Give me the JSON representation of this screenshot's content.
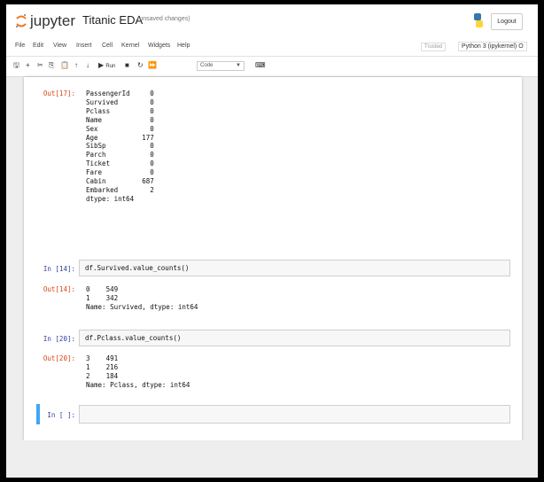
{
  "header": {
    "brand": "jupyter",
    "notebook_title": "Titanic EDA",
    "save_status": "(unsaved changes)",
    "logout_label": "Logout"
  },
  "menu": {
    "items": [
      "File",
      "Edit",
      "View",
      "Insert",
      "Cell",
      "Kernel",
      "Widgets",
      "Help"
    ],
    "trusted_label": "Trusted",
    "kernel_label": "Python 3 (ipykernel) O"
  },
  "toolbar": {
    "run_label": "Run",
    "cell_type": "Code"
  },
  "cells": {
    "out17": {
      "prompt": "Out[17]:",
      "text": "PassengerId     0\nSurvived        0\nPclass          0\nName            0\nSex             0\nAge           177\nSibSp           0\nParch           0\nTicket          0\nFare            0\nCabin         687\nEmbarked        2\ndtype: int64"
    },
    "in14": {
      "prompt": "In [14]:",
      "code": "df.Survived.value_counts()"
    },
    "out14": {
      "prompt": "Out[14]:",
      "text": "0    549\n1    342\nName: Survived, dtype: int64"
    },
    "in20": {
      "prompt": "In [20]:",
      "code": "df.Pclass.value_counts()"
    },
    "out20": {
      "prompt": "Out[20]:",
      "text": "3    491\n1    216\n2    184\nName: Pclass, dtype: int64"
    },
    "in_empty": {
      "prompt": "In [ ]:"
    }
  }
}
